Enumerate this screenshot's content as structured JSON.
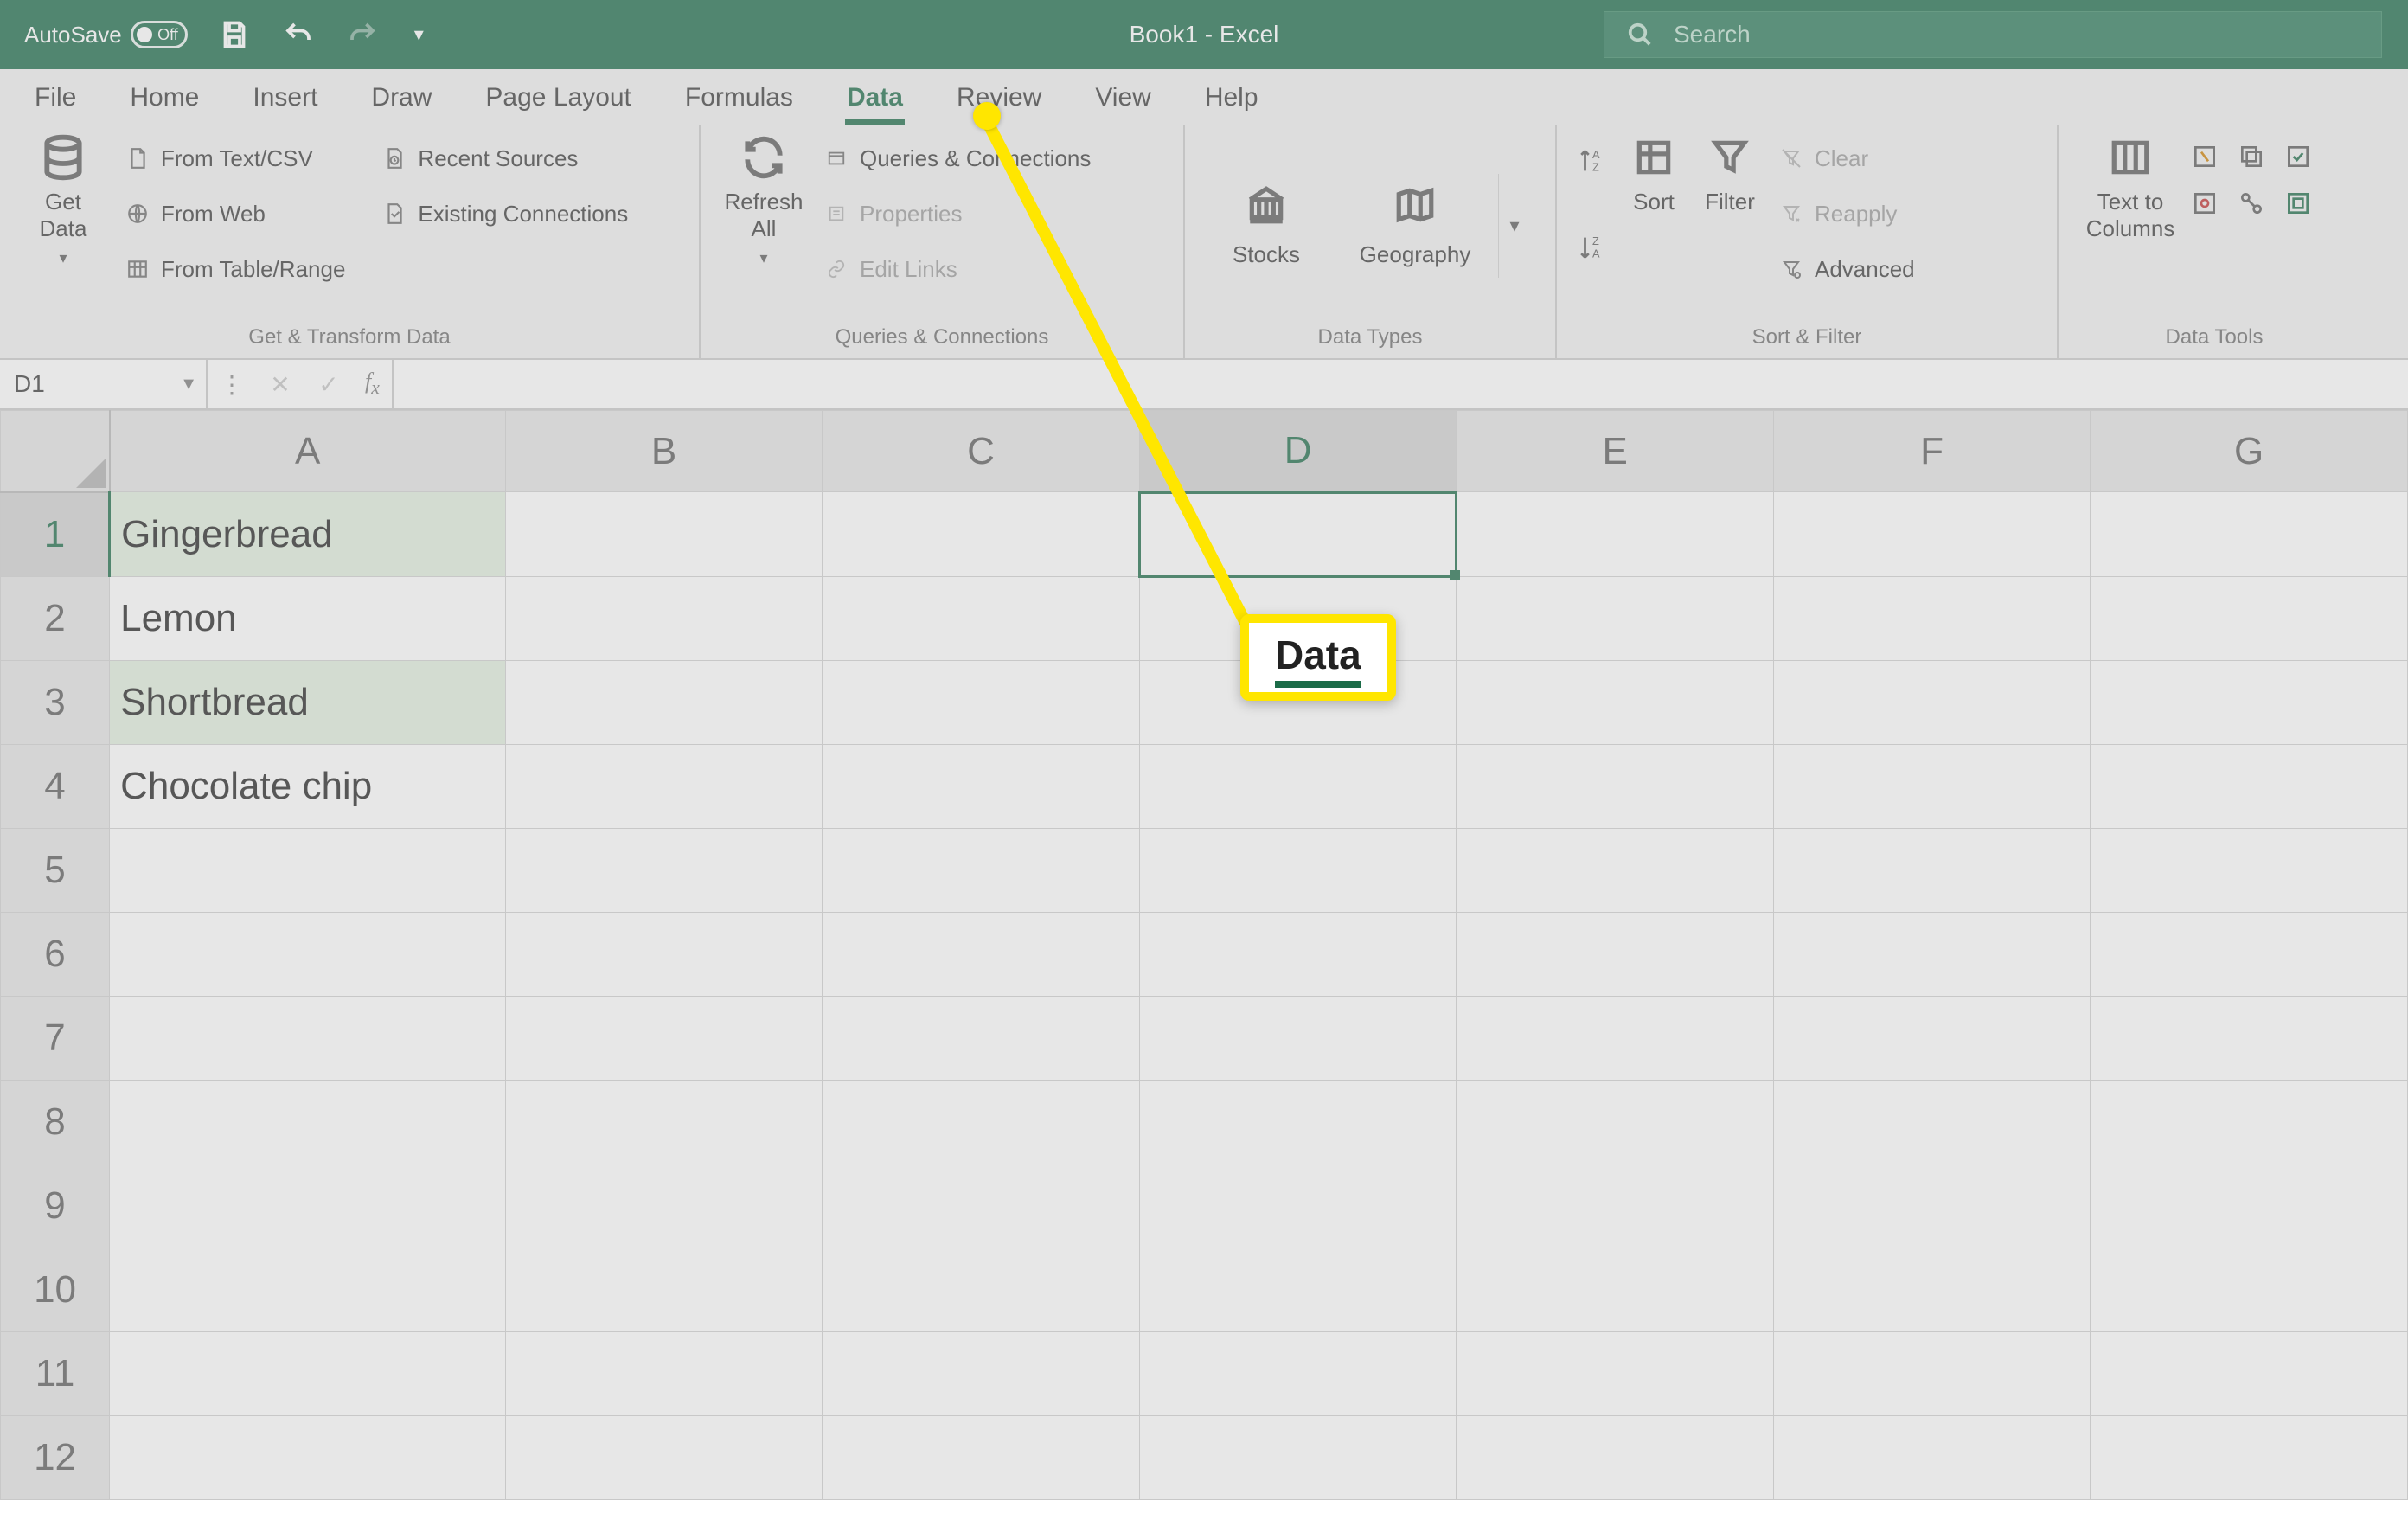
{
  "titlebar": {
    "autosave_label": "AutoSave",
    "autosave_state": "Off",
    "doc_title": "Book1  -  Excel",
    "search_placeholder": "Search"
  },
  "tabs": [
    "File",
    "Home",
    "Insert",
    "Draw",
    "Page Layout",
    "Formulas",
    "Data",
    "Review",
    "View",
    "Help"
  ],
  "active_tab": "Data",
  "ribbon": {
    "get_transform": {
      "get_data": "Get\nData",
      "items_left": [
        "From Text/CSV",
        "From Web",
        "From Table/Range"
      ],
      "items_right": [
        "Recent Sources",
        "Existing Connections"
      ],
      "label": "Get & Transform Data"
    },
    "queries": {
      "refresh": "Refresh\nAll",
      "items": [
        "Queries & Connections",
        "Properties",
        "Edit Links"
      ],
      "label": "Queries & Connections"
    },
    "datatypes": {
      "stocks": "Stocks",
      "geography": "Geography",
      "label": "Data Types"
    },
    "sortfilter": {
      "sort": "Sort",
      "filter": "Filter",
      "clear": "Clear",
      "reapply": "Reapply",
      "advanced": "Advanced",
      "label": "Sort & Filter"
    },
    "tools": {
      "text_to_columns": "Text to\nColumns",
      "label": "Data Tools"
    }
  },
  "formula_bar": {
    "name_box": "D1",
    "formula": ""
  },
  "grid": {
    "columns": [
      "A",
      "B",
      "C",
      "D",
      "E",
      "F",
      "G"
    ],
    "selected_column": "D",
    "selected_row": 1,
    "selected_cell": "D1",
    "row_count": 12,
    "highlighted_cells": [
      "A1",
      "A3"
    ],
    "data": {
      "A1": "Gingerbread",
      "A2": "Lemon",
      "A3": "Shortbread",
      "A4": "Chocolate chip"
    }
  },
  "callout": {
    "label": "Data"
  }
}
